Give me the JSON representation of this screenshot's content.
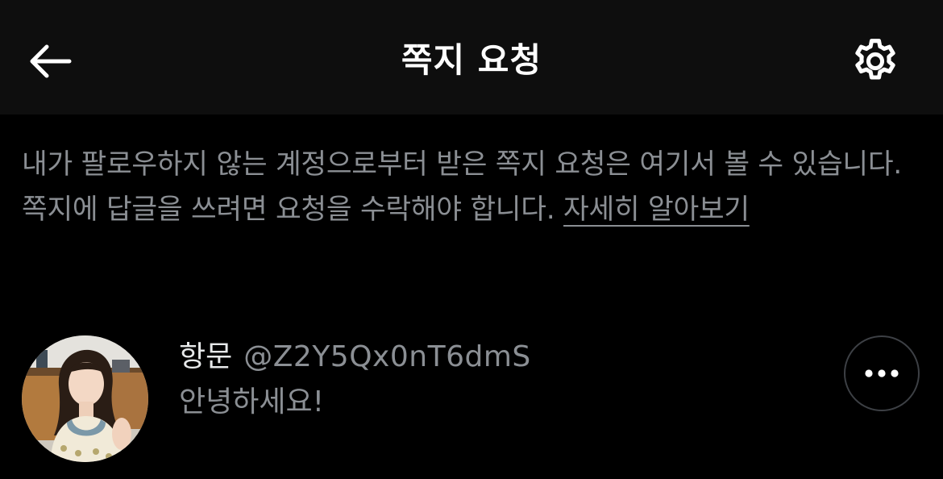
{
  "header": {
    "title": "쪽지 요청",
    "back_icon": "arrow-left-icon",
    "settings_icon": "gear-icon"
  },
  "info": {
    "text": "내가 팔로우하지 않는 계정으로부터 받은 쪽지 요청은 여기서 볼 수 있습니다. 쪽지에 답글을 쓰려면 요청을 수락해야 합니다. ",
    "link_label": "자세히 알아보기"
  },
  "requests": [
    {
      "name": "항문",
      "handle": "@Z2Y5Qx0nT6dmS",
      "preview": "안녕하세요!",
      "avatar_icon": "profile-photo",
      "more_icon": "more-horizontal-icon"
    }
  ],
  "colors": {
    "background": "#000000",
    "header_background": "#0e0e0e",
    "primary_text": "#e7e9ea",
    "secondary_text": "#8b8f94",
    "button_border": "#3d4045"
  }
}
